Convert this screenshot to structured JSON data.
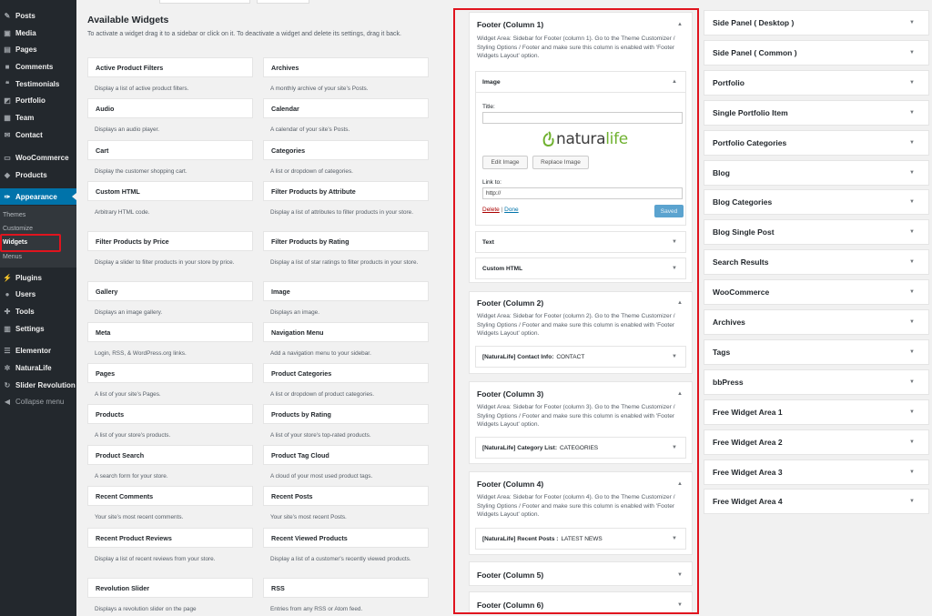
{
  "admin_menu": {
    "items": [
      {
        "label": "Posts",
        "icon": "pin-icon"
      },
      {
        "label": "Media",
        "icon": "media-icon"
      },
      {
        "label": "Pages",
        "icon": "pages-icon"
      },
      {
        "label": "Comments",
        "icon": "comments-icon"
      },
      {
        "label": "Testimonials",
        "icon": "quote-icon"
      },
      {
        "label": "Portfolio",
        "icon": "portfolio-icon"
      },
      {
        "label": "Team",
        "icon": "team-icon"
      },
      {
        "label": "Contact",
        "icon": "mail-icon"
      },
      {
        "label": "WooCommerce",
        "icon": "woo-icon"
      },
      {
        "label": "Products",
        "icon": "products-icon"
      },
      {
        "label": "Appearance",
        "icon": "brush-icon"
      },
      {
        "label": "Plugins",
        "icon": "plug-icon"
      },
      {
        "label": "Users",
        "icon": "user-icon"
      },
      {
        "label": "Tools",
        "icon": "wrench-icon"
      },
      {
        "label": "Settings",
        "icon": "settings-icon"
      },
      {
        "label": "Elementor",
        "icon": "elementor-icon"
      },
      {
        "label": "NaturaLife",
        "icon": "gear-icon"
      },
      {
        "label": "Slider Revolution",
        "icon": "refresh-icon"
      },
      {
        "label": "Collapse menu",
        "icon": "collapse-icon"
      }
    ],
    "appearance_sub": [
      "Themes",
      "Customize",
      "Widgets",
      "Menus"
    ]
  },
  "available": {
    "title": "Available Widgets",
    "description": "To activate a widget drag it to a sidebar or click on it. To deactivate a widget and delete its settings, drag it back.",
    "widgets": [
      {
        "name": "Active Product Filters",
        "desc": "Display a list of active product filters."
      },
      {
        "name": "Archives",
        "desc": "A monthly archive of your site’s Posts."
      },
      {
        "name": "Audio",
        "desc": "Displays an audio player."
      },
      {
        "name": "Calendar",
        "desc": "A calendar of your site’s Posts."
      },
      {
        "name": "Cart",
        "desc": "Display the customer shopping cart."
      },
      {
        "name": "Categories",
        "desc": "A list or dropdown of categories."
      },
      {
        "name": "Custom HTML",
        "desc": "Arbitrary HTML code."
      },
      {
        "name": "Filter Products by Attribute",
        "desc": "Display a list of attributes to filter products in your store."
      },
      {
        "name": "Filter Products by Price",
        "desc": "Display a slider to filter products in your store by price."
      },
      {
        "name": "Filter Products by Rating",
        "desc": "Display a list of star ratings to filter products in your store."
      },
      {
        "name": "Gallery",
        "desc": "Displays an image gallery."
      },
      {
        "name": "Image",
        "desc": "Displays an image."
      },
      {
        "name": "Meta",
        "desc": "Login, RSS, & WordPress.org links."
      },
      {
        "name": "Navigation Menu",
        "desc": "Add a navigation menu to your sidebar."
      },
      {
        "name": "Pages",
        "desc": "A list of your site’s Pages."
      },
      {
        "name": "Product Categories",
        "desc": "A list or dropdown of product categories."
      },
      {
        "name": "Products",
        "desc": "A list of your store's products."
      },
      {
        "name": "Products by Rating",
        "desc": "A list of your store's top-rated products."
      },
      {
        "name": "Product Search",
        "desc": "A search form for your store."
      },
      {
        "name": "Product Tag Cloud",
        "desc": "A cloud of your most used product tags."
      },
      {
        "name": "Recent Comments",
        "desc": "Your site’s most recent comments."
      },
      {
        "name": "Recent Posts",
        "desc": "Your site’s most recent Posts."
      },
      {
        "name": "Recent Product Reviews",
        "desc": "Display a list of recent reviews from your store."
      },
      {
        "name": "Recent Viewed Products",
        "desc": "Display a list of a customer's recently viewed products."
      },
      {
        "name": "Revolution Slider",
        "desc": "Displays a revolution slider on the page"
      },
      {
        "name": "RSS",
        "desc": "Entries from any RSS or Atom feed."
      }
    ]
  },
  "footer": {
    "col1": {
      "title": "Footer (Column 1)",
      "desc": "Widget Area: Sidebar for Footer (column 1). Go to the Theme Customizer / Styling Options / Footer and make sure this column is enabled with 'Footer Widgets Layout' option.",
      "image_widget": {
        "title": "Image",
        "title_label": "Title:",
        "title_value": "",
        "logo_text_a": "natura",
        "logo_text_b": "life",
        "edit_label": "Edit Image",
        "replace_label": "Replace Image",
        "link_label": "Link to:",
        "link_value": "http://",
        "delete_label": "Delete",
        "separator": "|",
        "done_label": "Done",
        "saved_label": "Saved"
      },
      "text_widget": "Text",
      "html_widget": "Custom HTML"
    },
    "col2": {
      "title": "Footer (Column 2)",
      "desc": "Widget Area: Sidebar for Footer (column 2). Go to the Theme Customizer / Styling Options / Footer and make sure this column is enabled with 'Footer Widgets Layout' option.",
      "widget_name": "[NaturaLife] Contact Info:",
      "widget_sub": "CONTACT"
    },
    "col3": {
      "title": "Footer (Column 3)",
      "desc": "Widget Area: Sidebar for Footer (column 3). Go to the Theme Customizer / Styling Options / Footer and make sure this column is enabled with 'Footer Widgets Layout' option.",
      "widget_name": "[NaturaLife] Category List:",
      "widget_sub": "CATEGORIES"
    },
    "col4": {
      "title": "Footer (Column 4)",
      "desc": "Widget Area: Sidebar for Footer (column 4). Go to the Theme Customizer / Styling Options / Footer and make sure this column is enabled with 'Footer Widgets Layout' option.",
      "widget_name": "[NaturaLife] Recent Posts :",
      "widget_sub": "LATEST NEWS"
    },
    "col5": {
      "title": "Footer (Column 5)"
    },
    "col6": {
      "title": "Footer (Column 6)"
    }
  },
  "right_sidebars": [
    "Side Panel ( Desktop )",
    "Side Panel ( Common )",
    "Portfolio",
    "Single Portfolio Item",
    "Portfolio Categories",
    "Blog",
    "Blog Categories",
    "Blog Single Post",
    "Search Results",
    "WooCommerce",
    "Archives",
    "Tags",
    "bbPress",
    "Free Widget Area 1",
    "Free Widget Area 2",
    "Free Widget Area 3",
    "Free Widget Area 4"
  ],
  "colors": {
    "admin_bg": "#23282d",
    "active": "#0073aa",
    "highlight": "#e0141e",
    "logo_green": "#6fb12f"
  }
}
